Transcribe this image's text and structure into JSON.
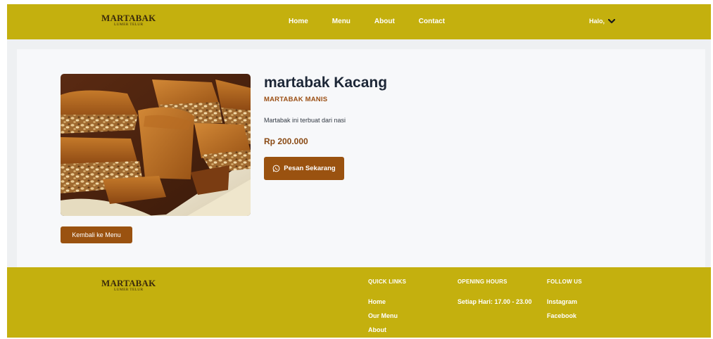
{
  "brand": {
    "name": "MARTABAK",
    "tagline": "LUMER TELUR"
  },
  "nav": {
    "items": [
      {
        "label": "Home"
      },
      {
        "label": "Menu"
      },
      {
        "label": "About"
      },
      {
        "label": "Contact"
      }
    ],
    "user_label": "Halo,"
  },
  "product": {
    "title": "martabak Kacang",
    "category": "MARTABAK MANIS",
    "description": "Martabak ini terbuat dari nasi",
    "price": "Rp 200.000",
    "order_label": "Pesan Sekarang",
    "back_label": "Kembali ke Menu"
  },
  "footer": {
    "quick_links": {
      "heading": "QUICK LINKS",
      "items": [
        "Home",
        "Our Menu",
        "About"
      ]
    },
    "opening_hours": {
      "heading": "OPENING HOURS",
      "text": "Setiap Hari: 17.00 - 23.00"
    },
    "follow_us": {
      "heading": "FOLLOW US",
      "items": [
        "Instagram",
        "Facebook"
      ]
    }
  },
  "colors": {
    "header_bg": "#c4b00e",
    "accent_button": "#9a5210",
    "title_text": "#1d2737",
    "category_text": "#9b4f14"
  },
  "icons": {
    "order_button": "whatsapp-icon",
    "user_menu": "chevron-down-icon"
  }
}
